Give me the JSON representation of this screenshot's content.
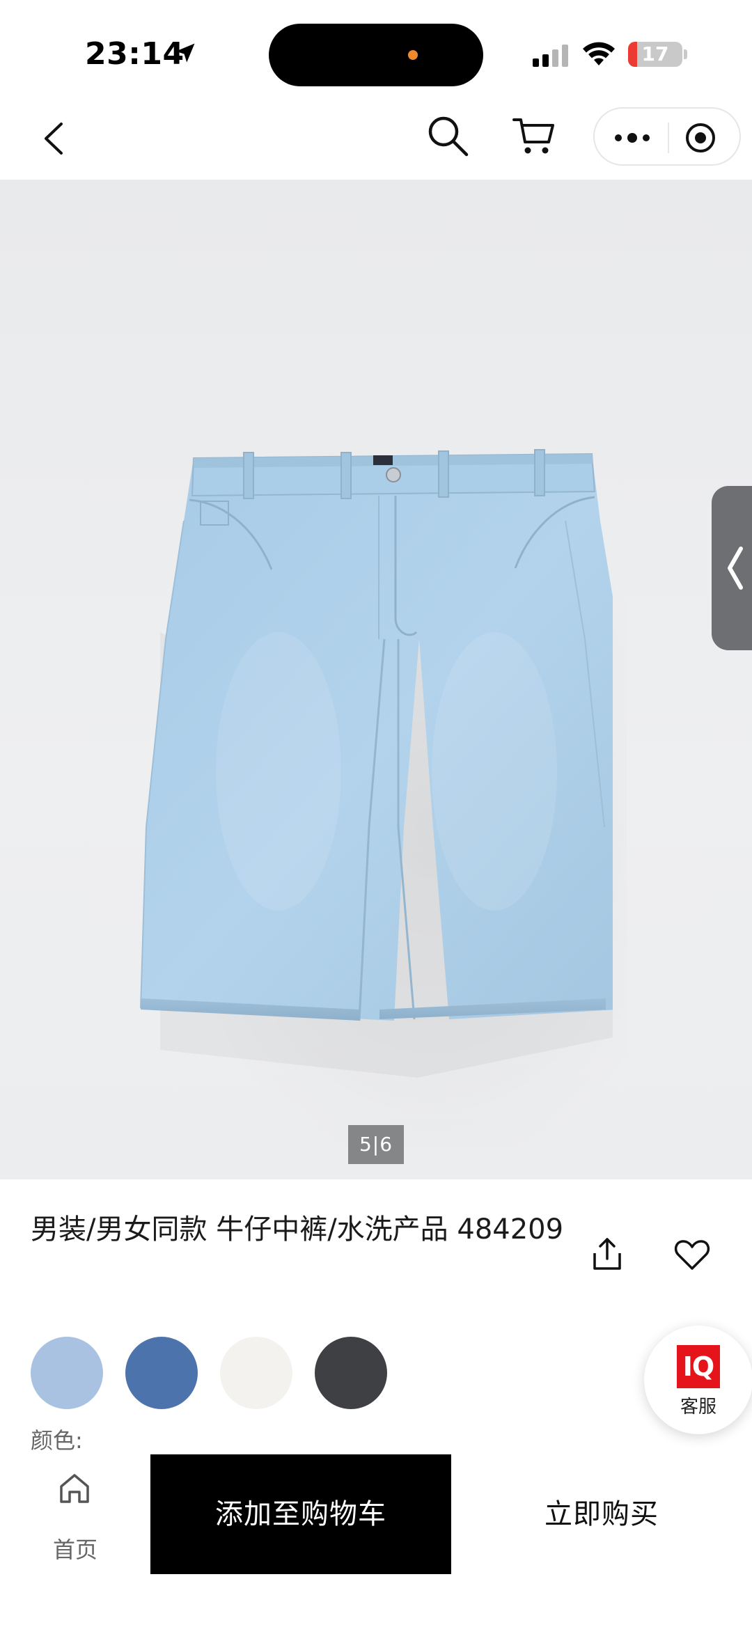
{
  "status_bar": {
    "time": "23:14",
    "battery_level": "17",
    "battery_fraction": 0.17,
    "icons": [
      "location-arrow-icon",
      "signal-icon",
      "wifi-icon",
      "battery-icon"
    ],
    "recording_dot_color": "#f08a2c",
    "battery_color": "#eb3b33"
  },
  "nav": {
    "icons": [
      "back-arrow-icon",
      "search-icon",
      "cart-icon",
      "more-dots-icon",
      "close-target-icon"
    ]
  },
  "gallery": {
    "pager_current": "5",
    "pager_total": "6",
    "pager_separator": "|",
    "image": "light-blue-denim-shorts",
    "side_tab_icon": "chevron-left-icon"
  },
  "product": {
    "title": "男装/男女同款 牛仔中裤/水洗产品 484209",
    "share_icon": "share-icon",
    "favorite_icon": "heart-icon",
    "color_label": "颜色:",
    "swatches": [
      {
        "name": "light-blue",
        "color": "#a9c2e2"
      },
      {
        "name": "blue",
        "color": "#4c73ab"
      },
      {
        "name": "off-white",
        "color": "#f3f2ee"
      },
      {
        "name": "black",
        "color": "#3f4043"
      }
    ]
  },
  "service": {
    "logo_text": "IQ",
    "label": "客服",
    "logo_color": "#e5141b"
  },
  "bottom_bar": {
    "home_label": "首页",
    "add_to_cart_label": "添加至购物车",
    "buy_now_label": "立即购买"
  }
}
